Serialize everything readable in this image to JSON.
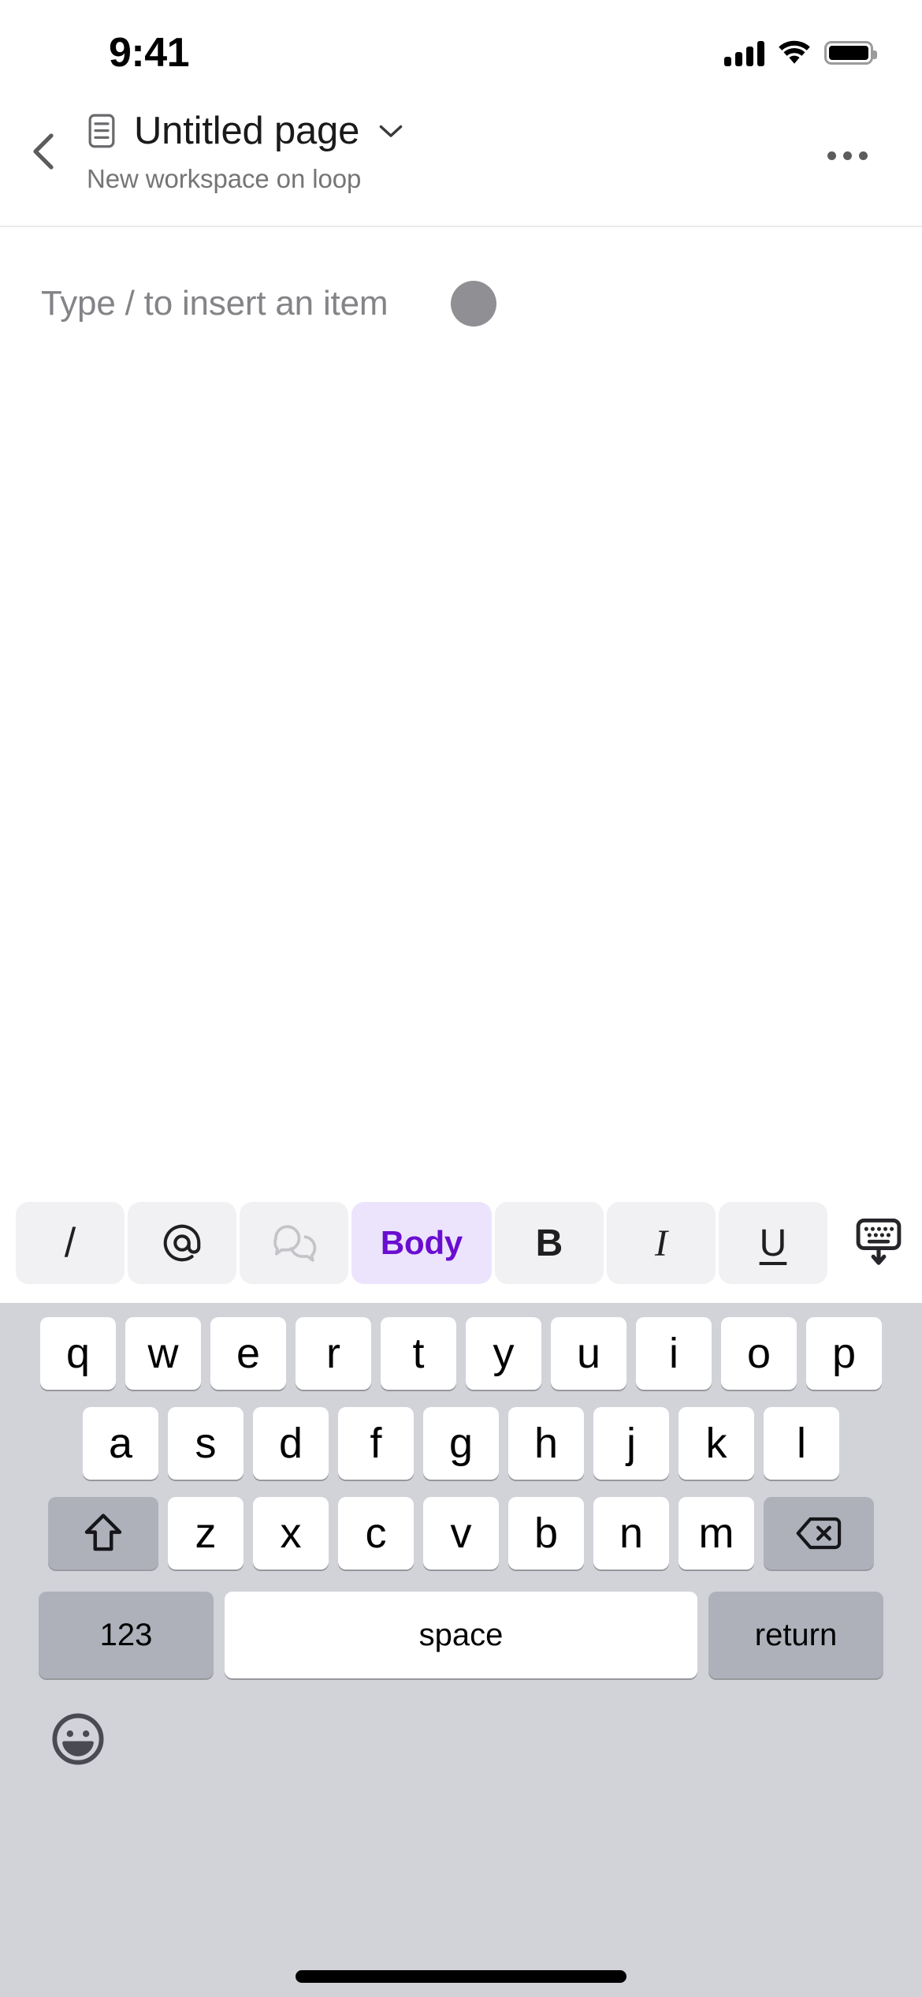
{
  "status_bar": {
    "time": "9:41",
    "signal_icon": "cellular-signal-icon",
    "wifi_icon": "wifi-icon",
    "battery_icon": "battery-full-icon"
  },
  "header": {
    "back_icon": "chevron-left-icon",
    "doc_icon": "document-page-icon",
    "title": "Untitled page",
    "title_chevron_icon": "chevron-down-icon",
    "subtitle": "New workspace on loop",
    "more_icon": "ellipsis-horizontal-icon"
  },
  "document": {
    "placeholder": "Type / to insert an item",
    "avatar_name": "presence-avatar",
    "avatar_color": "#909094"
  },
  "format_toolbar": {
    "buttons": [
      {
        "name": "insert-slash-button",
        "label": "/",
        "icon": "slash-icon",
        "active": false,
        "disabled": false
      },
      {
        "name": "mention-button",
        "label": "@",
        "icon": "at-mention-icon",
        "active": false,
        "disabled": false
      },
      {
        "name": "comment-button",
        "label": "",
        "icon": "comment-bubbles-icon",
        "active": false,
        "disabled": true
      },
      {
        "name": "text-style-button",
        "label": "Body",
        "icon": "text-style-icon",
        "active": true,
        "disabled": false
      },
      {
        "name": "bold-button",
        "label": "B",
        "icon": "bold-icon",
        "active": false,
        "disabled": false
      },
      {
        "name": "italic-button",
        "label": "I",
        "icon": "italic-icon",
        "active": false,
        "disabled": false
      },
      {
        "name": "underline-button",
        "label": "U",
        "icon": "underline-icon",
        "active": false,
        "disabled": false
      }
    ],
    "dismiss_keyboard_icon": "keyboard-dismiss-icon",
    "active_color": "#6a0dd0",
    "active_background": "#ece4fd",
    "button_background": "#f1f0f3"
  },
  "keyboard": {
    "row1": [
      "q",
      "w",
      "e",
      "r",
      "t",
      "y",
      "u",
      "i",
      "o",
      "p"
    ],
    "row2": [
      "a",
      "s",
      "d",
      "f",
      "g",
      "h",
      "j",
      "k",
      "l"
    ],
    "row3_letters": [
      "z",
      "x",
      "c",
      "v",
      "b",
      "n",
      "m"
    ],
    "shift_icon": "shift-arrow-up-icon",
    "backspace_icon": "backspace-delete-icon",
    "numeric_label": "123",
    "space_label": "space",
    "return_label": "return",
    "emoji_icon": "emoji-smiley-icon",
    "background_color": "#d1d3d9",
    "key_color": "#ffffff",
    "mod_key_color": "#aeb1ba"
  },
  "home_indicator": {
    "name": "home-indicator"
  }
}
